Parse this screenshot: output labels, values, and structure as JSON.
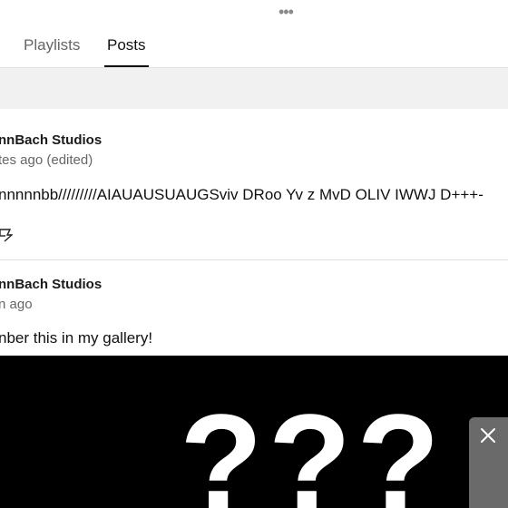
{
  "header": {
    "more_icon": "more-horizontal-icon"
  },
  "tabs": [
    {
      "label": "Playlists",
      "active": false
    },
    {
      "label": "Posts",
      "active": true
    }
  ],
  "posts": [
    {
      "author": "nnBach Studios",
      "time": "tes ago (edited)",
      "text": "nnnnnbb/////////AIAUAUSUAUGSviv DRoo Yv z MvD OLIV IWWJ D+++-",
      "like_icon": "thumbs-up-icon"
    },
    {
      "author": "nnBach Studios",
      "time": "n ago",
      "text": "nber this in my gallery!",
      "image_text": "???"
    }
  ],
  "overlay": {
    "close_icon": "close-icon"
  },
  "colors": {
    "accent_underline": "#111111",
    "band": "#f1f1f1",
    "image_bg": "#000000"
  }
}
